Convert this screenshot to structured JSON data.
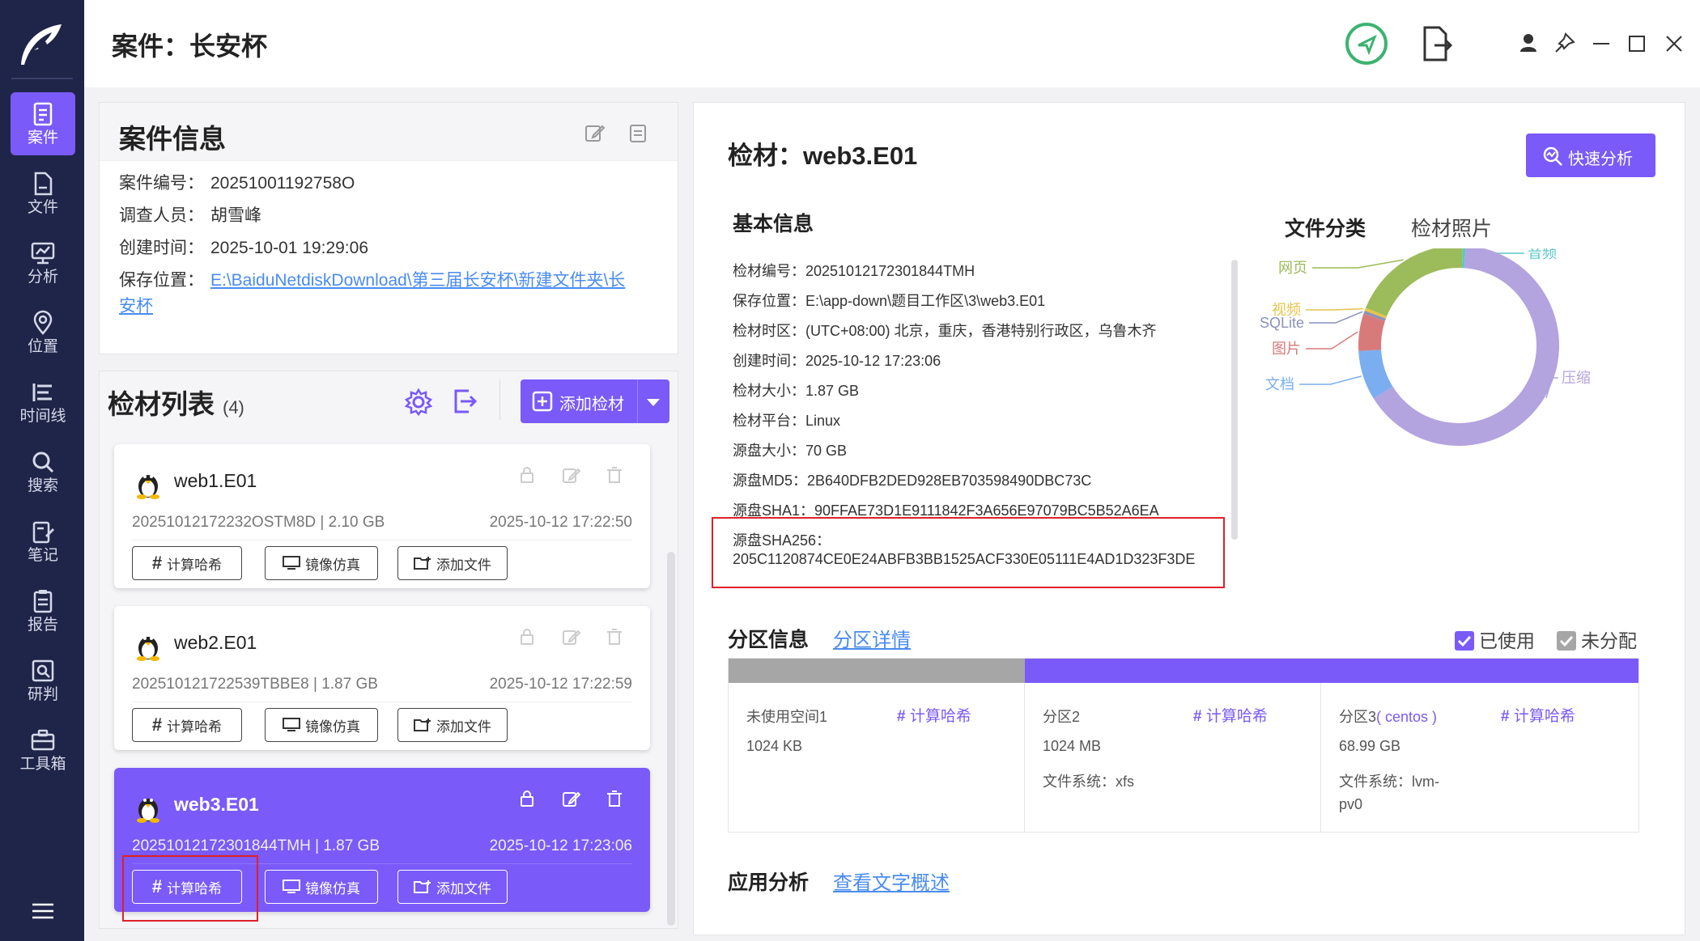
{
  "window": {
    "case_title": "案件：长安杯"
  },
  "sidebar": {
    "items": [
      {
        "label": "案件",
        "icon": "case-icon",
        "active": true
      },
      {
        "label": "文件",
        "icon": "file-icon"
      },
      {
        "label": "分析",
        "icon": "analysis-icon"
      },
      {
        "label": "位置",
        "icon": "location-icon"
      },
      {
        "label": "时间线",
        "icon": "timeline-icon"
      },
      {
        "label": "搜索",
        "icon": "search-icon"
      },
      {
        "label": "笔记",
        "icon": "note-icon"
      },
      {
        "label": "报告",
        "icon": "report-icon"
      },
      {
        "label": "研判",
        "icon": "judge-icon"
      },
      {
        "label": "工具箱",
        "icon": "toolbox-icon"
      }
    ]
  },
  "case_info": {
    "title": "案件信息",
    "rows": [
      {
        "key": "案件编号：",
        "value": "20251001192758O"
      },
      {
        "key": "调查人员：",
        "value": "胡雪峰"
      },
      {
        "key": "创建时间：",
        "value": "2025-10-01 19:29:06"
      }
    ],
    "save_key": "保存位置：",
    "save_path_line1": "E:\\BaiduNetdiskDownload\\第三届长安杯\\新建文件夹\\长",
    "save_path_line2": "安杯"
  },
  "evidence_list": {
    "title": "检材列表",
    "count": "(4)",
    "add_label": "添加检材",
    "buttons": {
      "hash": "计算哈希",
      "mirror": "镜像仿真",
      "add_file": "添加文件"
    },
    "items": [
      {
        "name": "web1.E01",
        "meta": "20251012172232OSTM8D | 2.10 GB",
        "date": "2025-10-12 17:22:50"
      },
      {
        "name": "web2.E01",
        "meta": "202510121722539TBBE8 | 1.87 GB",
        "date": "2025-10-12 17:22:59"
      },
      {
        "name": "web3.E01",
        "meta": "20251012172301844TMH | 1.87 GB",
        "date": "2025-10-12 17:23:06"
      }
    ]
  },
  "evidence_detail": {
    "title": "检材：web3.E01",
    "quick_label": "快速分析",
    "basic_title": "基本信息",
    "rows": [
      "检材编号：20251012172301844TMH",
      "保存位置：E:\\app-down\\题目工作区\\3\\web3.E01",
      "检材时区：(UTC+08:00) 北京，重庆，香港特别行政区，乌鲁木齐",
      "创建时间：2025-10-12 17:23:06",
      "检材大小：1.87 GB",
      "检材平台：Linux",
      "源盘大小：70 GB",
      "源盘MD5：2B640DFB2DED928EB703598490DBC73C",
      "源盘SHA1：90FFAE73D1E9111842F3A656E97079BC5B52A6EA"
    ],
    "sha256_key": "源盘SHA256：",
    "sha256_value": "205C1120874CE0E24ABFB3BB1525ACF330E05111E4AD1D323F3DE",
    "tabs": [
      "文件分类",
      "检材照片"
    ]
  },
  "chart_data": {
    "type": "pie",
    "labels": [
      "音频",
      "压缩",
      "文档",
      "图片",
      "SQLite",
      "视频",
      "网页"
    ],
    "values": [
      0.5,
      65,
      8,
      6,
      0.5,
      0.5,
      19.5
    ],
    "colors": [
      "#5cc8c8",
      "#b3a3df",
      "#7aaef0",
      "#d97a7a",
      "#8a92b8",
      "#e6c44a",
      "#9cbb5a"
    ]
  },
  "partitions": {
    "title": "分区信息",
    "detail_link": "分区详情",
    "legend_used": "已使用",
    "legend_unalloc": "未分配",
    "hash_label": "计算哈希",
    "items": [
      {
        "name": "未使用空间1",
        "size": "1024 KB",
        "fs": "",
        "bar": "#a6a6a6"
      },
      {
        "name": "分区2",
        "size": "1024 MB",
        "fs": "文件系统：xfs",
        "bar": "#7a5af8"
      },
      {
        "name": "分区3",
        "name_suffix": "( centos )",
        "size": "68.99 GB",
        "fs": "文件系统：lvm-",
        "fs2": "pv0",
        "bar": "#7a5af8"
      }
    ]
  },
  "app_analysis": {
    "title": "应用分析",
    "link": "查看文字概述"
  }
}
